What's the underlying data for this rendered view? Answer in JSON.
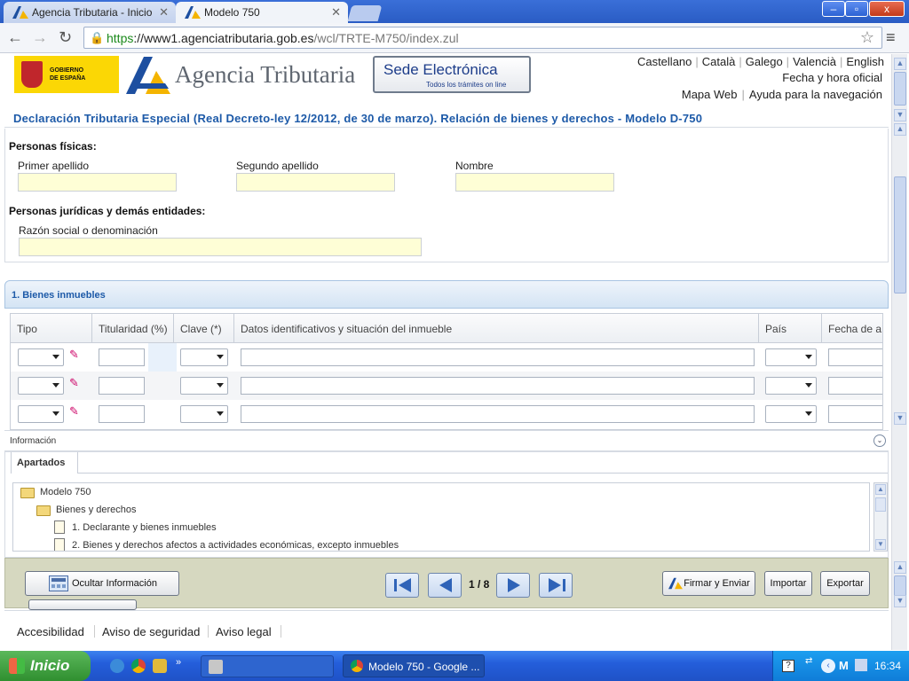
{
  "browser": {
    "tabs": [
      {
        "title": "Agencia Tributaria - Inicio"
      },
      {
        "title": "Modelo 750"
      }
    ],
    "url": {
      "scheme": "https",
      "host": "://www1.agenciatributaria.gob.es",
      "path": "/wcl/TRTE-M750/index.zul"
    },
    "window_buttons": {
      "minimize": "–",
      "maximize": "▫",
      "close": "x"
    }
  },
  "header": {
    "gobierno_text": "GOBIERNO\nDE ESPAÑA",
    "agency_name": "Agencia Tributaria",
    "sede_title": "Sede Electrónica",
    "sede_subtitle": "Todos los trámites on line",
    "languages": [
      "Castellano",
      "Català",
      "Galego",
      "Valencià",
      "English"
    ],
    "fecha_hora": "Fecha y hora oficial",
    "mapa_web": "Mapa Web",
    "ayuda": "Ayuda para la navegación"
  },
  "document_title": "Declaración Tributaria Especial (Real Decreto-ley 12/2012, de 30 de marzo). Relación de bienes y derechos - Modelo D-750",
  "personas_fisicas": {
    "title": "Personas físicas:",
    "primer_apellido": "Primer apellido",
    "segundo_apellido": "Segundo apellido",
    "nombre": "Nombre"
  },
  "personas_juridicas": {
    "title": "Personas jurídicas y demás entidades:",
    "razon_social": "Razón social o denominación"
  },
  "bienes_inmuebles": {
    "title": "1. Bienes inmuebles",
    "columns": [
      "Tipo",
      "Titularidad (%)",
      "Clave  (*)",
      "Datos identificativos y situación del inmueble",
      "País",
      "Fecha de a"
    ],
    "row_count": 3
  },
  "informacion": {
    "label": "Información",
    "tab": "Apartados",
    "tree": [
      {
        "label": "Modelo 750",
        "kind": "folder"
      },
      {
        "label": "Bienes y derechos",
        "kind": "folder"
      },
      {
        "label": "1. Declarante y bienes inmuebles",
        "kind": "doc"
      },
      {
        "label": "2. Bienes y derechos afectos a actividades económicas, excepto inmuebles",
        "kind": "doc"
      }
    ]
  },
  "bottom_bar": {
    "ocultar": "Ocultar Información",
    "page_indicator": "1 / 8",
    "firmar": "Firmar y Enviar",
    "importar": "Importar",
    "exportar": "Exportar"
  },
  "footer": {
    "links": [
      "Accesibilidad",
      "Aviso de seguridad",
      "Aviso legal"
    ]
  },
  "taskbar": {
    "start": "Inicio",
    "task": "Modelo 750 - Google ...",
    "time": "16:34"
  },
  "colors": {
    "title_blue": "#1d5aa8",
    "field_yellow": "#fefed6",
    "bottom_bar": "#d6d8c0",
    "taskbar_blue": "#245edb"
  }
}
